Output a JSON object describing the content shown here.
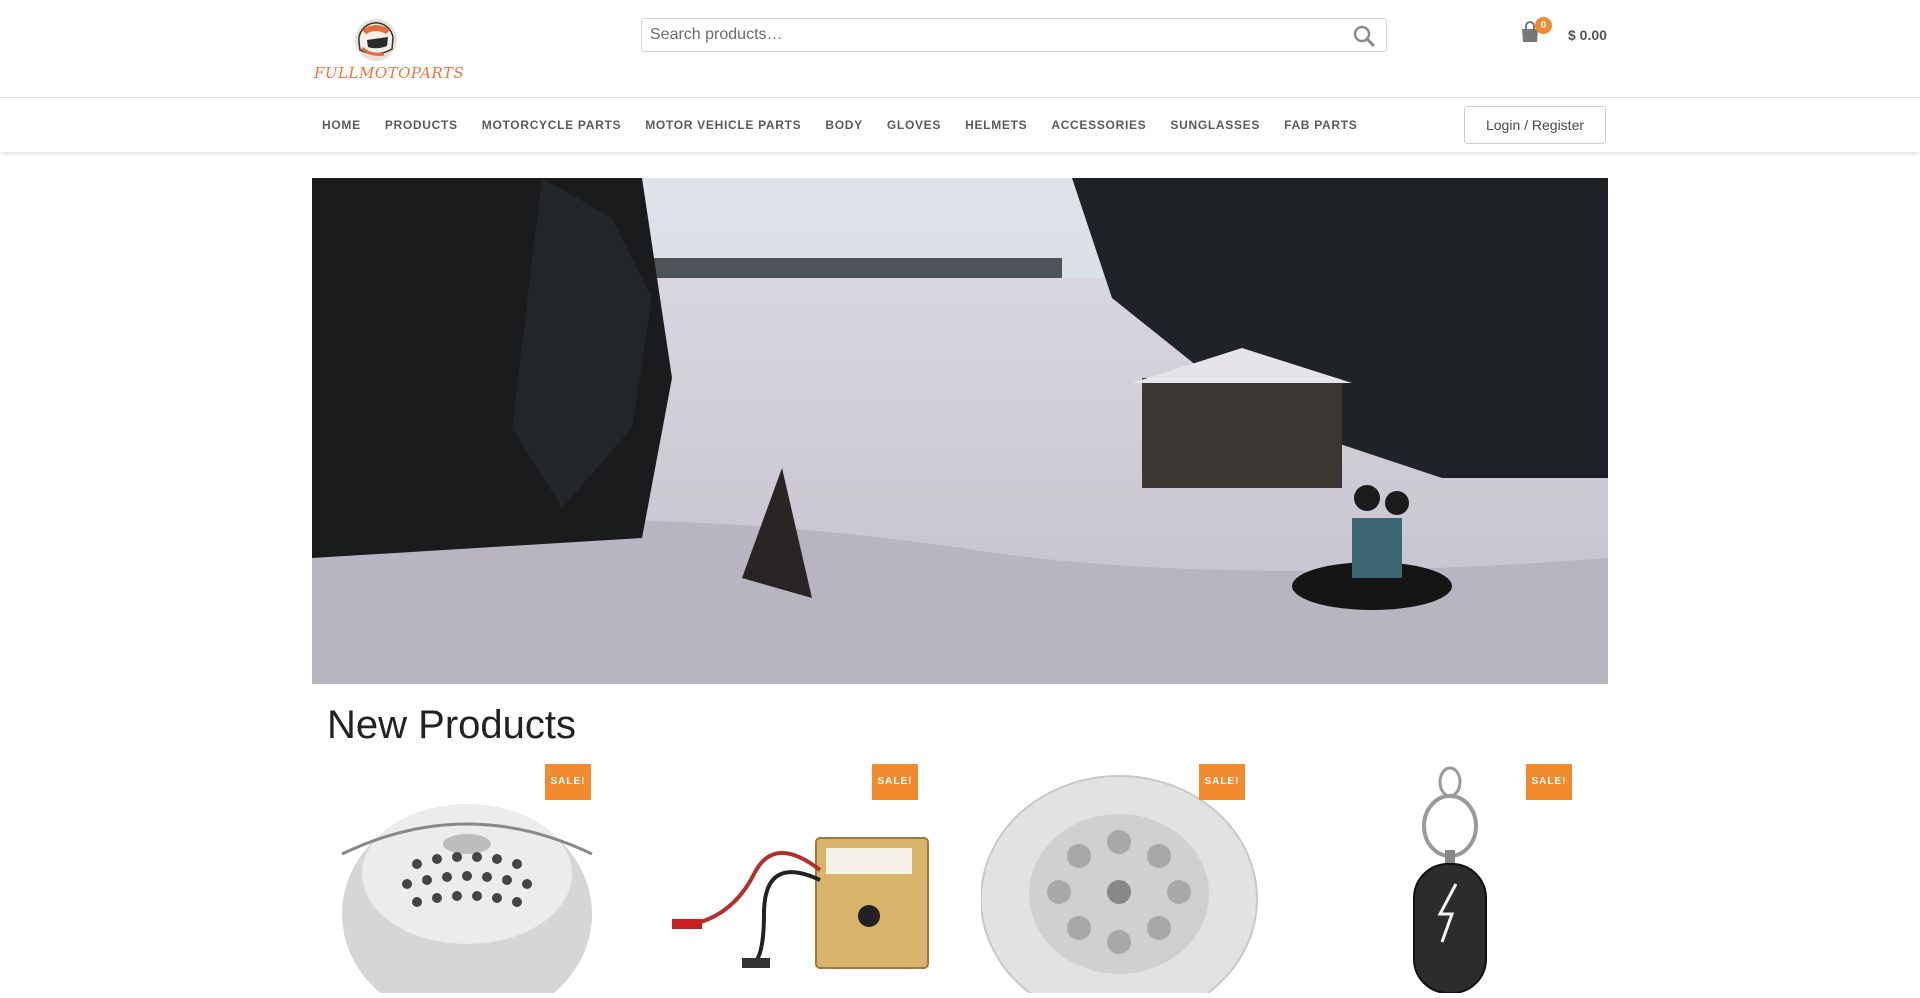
{
  "header": {
    "logo_text": "FULLMOTOPARTS",
    "search": {
      "placeholder": "Search products…"
    },
    "cart": {
      "count": "0",
      "total": "$ 0.00"
    }
  },
  "nav": {
    "items": [
      {
        "label": "HOME"
      },
      {
        "label": "PRODUCTS"
      },
      {
        "label": "MOTORCYCLE PARTS"
      },
      {
        "label": "MOTOR VEHICLE PARTS"
      },
      {
        "label": "BODY"
      },
      {
        "label": "GLOVES"
      },
      {
        "label": "HELMETS"
      },
      {
        "label": "ACCESSORIES"
      },
      {
        "label": "SUNGLASSES"
      },
      {
        "label": "FAB PARTS"
      }
    ],
    "login_label": "Login / Register"
  },
  "main": {
    "section_title": "New Products",
    "products": [
      {
        "badge": "SALE!",
        "image": "metal-cover-image"
      },
      {
        "badge": "SALE!",
        "image": "tester-box-image"
      },
      {
        "badge": "SALE!",
        "image": "wheel-cover-image"
      },
      {
        "badge": "SALE!",
        "image": "keychain-remote-image"
      }
    ]
  },
  "colors": {
    "accent": "#f28a2e",
    "logo": "#f0743e"
  }
}
